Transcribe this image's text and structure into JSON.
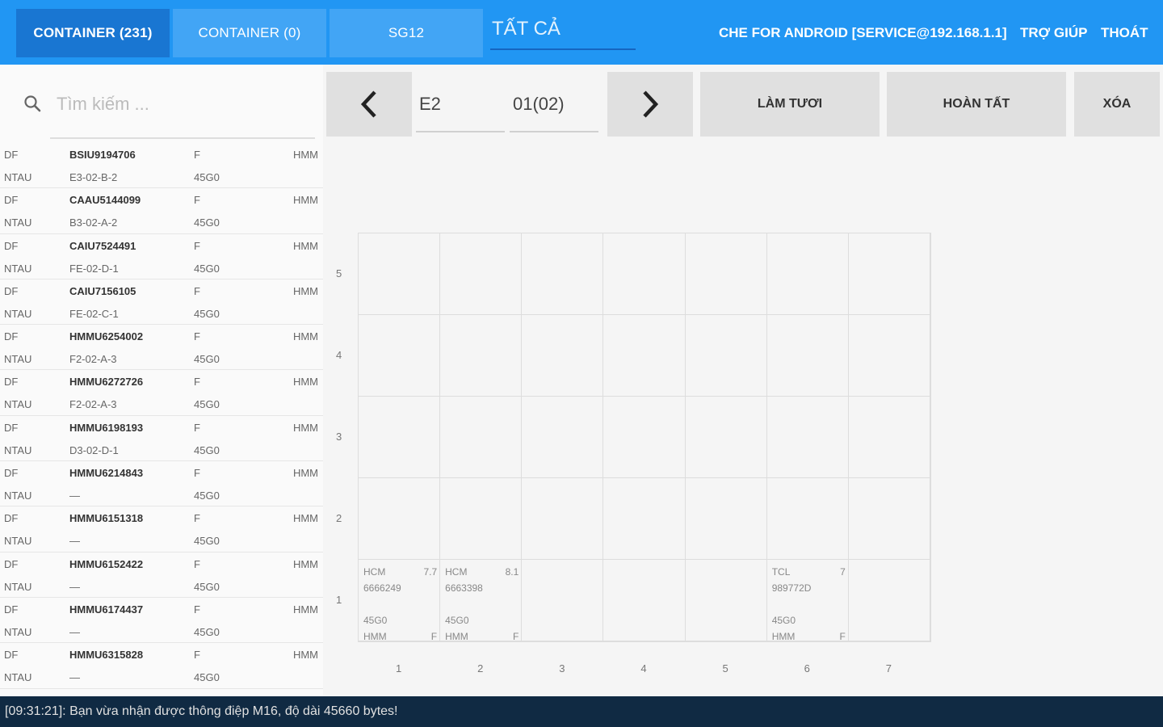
{
  "header": {
    "tabs": [
      {
        "label": "CONTAINER (231)"
      },
      {
        "label": "CONTAINER (0)"
      },
      {
        "label": "SG12"
      }
    ],
    "filter_value": "TẤT CẢ",
    "app_title": "CHE FOR ANDROID [SERVICE@192.168.1.1]",
    "help_label": "TRỢ GIÚP",
    "exit_label": "THOÁT"
  },
  "search": {
    "placeholder": "Tìm kiếm ..."
  },
  "containers": [
    {
      "code": "DF",
      "id": "BSIU9194706",
      "fe": "F",
      "op": "HMM",
      "vessel": "NTAU",
      "pos": "E3-02-B-2",
      "iso": "45G0"
    },
    {
      "code": "DF",
      "id": "CAAU5144099",
      "fe": "F",
      "op": "HMM",
      "vessel": "NTAU",
      "pos": "B3-02-A-2",
      "iso": "45G0"
    },
    {
      "code": "DF",
      "id": "CAIU7524491",
      "fe": "F",
      "op": "HMM",
      "vessel": "NTAU",
      "pos": "FE-02-D-1",
      "iso": "45G0"
    },
    {
      "code": "DF",
      "id": "CAIU7156105",
      "fe": "F",
      "op": "HMM",
      "vessel": "NTAU",
      "pos": "FE-02-C-1",
      "iso": "45G0"
    },
    {
      "code": "DF",
      "id": "HMMU6254002",
      "fe": "F",
      "op": "HMM",
      "vessel": "NTAU",
      "pos": "F2-02-A-3",
      "iso": "45G0"
    },
    {
      "code": "DF",
      "id": "HMMU6272726",
      "fe": "F",
      "op": "HMM",
      "vessel": "NTAU",
      "pos": "F2-02-A-3",
      "iso": "45G0"
    },
    {
      "code": "DF",
      "id": "HMMU6198193",
      "fe": "F",
      "op": "HMM",
      "vessel": "NTAU",
      "pos": "D3-02-D-1",
      "iso": "45G0"
    },
    {
      "code": "DF",
      "id": "HMMU6214843",
      "fe": "F",
      "op": "HMM",
      "vessel": "NTAU",
      "pos": "—",
      "iso": "45G0"
    },
    {
      "code": "DF",
      "id": "HMMU6151318",
      "fe": "F",
      "op": "HMM",
      "vessel": "NTAU",
      "pos": "—",
      "iso": "45G0"
    },
    {
      "code": "DF",
      "id": "HMMU6152422",
      "fe": "F",
      "op": "HMM",
      "vessel": "NTAU",
      "pos": "—",
      "iso": "45G0"
    },
    {
      "code": "DF",
      "id": "HMMU6174437",
      "fe": "F",
      "op": "HMM",
      "vessel": "NTAU",
      "pos": "—",
      "iso": "45G0"
    },
    {
      "code": "DF",
      "id": "HMMU6315828",
      "fe": "F",
      "op": "HMM",
      "vessel": "NTAU",
      "pos": "—",
      "iso": "45G0"
    }
  ],
  "controls": {
    "block_value": "E2",
    "bay_value": "01(02)",
    "refresh_label": "LÀM TƯƠI",
    "complete_label": "HOÀN TẤT",
    "delete_label": "XÓA"
  },
  "bay_plan": {
    "tiers": [
      "5",
      "4",
      "3",
      "2",
      "1"
    ],
    "rows": [
      "1",
      "2",
      "3",
      "4",
      "5",
      "6",
      "7"
    ],
    "containers": [
      {
        "row": 1,
        "tier": 1,
        "pod": "HCM",
        "weight": "7.7",
        "number": "6666249",
        "iso": "45G0",
        "op": "HMM",
        "fe": "F"
      },
      {
        "row": 2,
        "tier": 1,
        "pod": "HCM",
        "weight": "8.1",
        "number": "6663398",
        "iso": "45G0",
        "op": "HMM",
        "fe": "F"
      },
      {
        "row": 6,
        "tier": 1,
        "pod": "TCL",
        "weight": "7",
        "number": "989772D",
        "iso": "45G0",
        "op": "HMM",
        "fe": "F"
      }
    ]
  },
  "status": {
    "message": "[09:31:21]: Bạn vừa nhận được thông điệp M16, độ dài 45660 bytes!"
  }
}
